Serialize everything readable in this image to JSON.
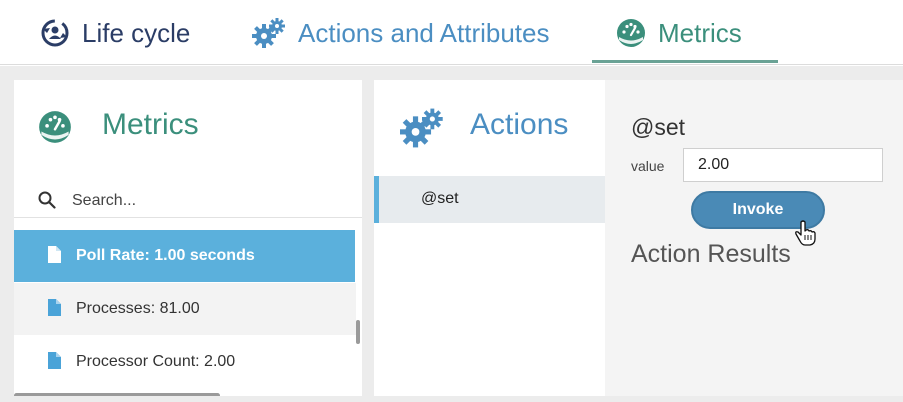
{
  "tabs": [
    {
      "label": "Life cycle",
      "icon": "lifecycle-icon",
      "color": "#2b3d66"
    },
    {
      "label": "Actions and Attributes",
      "icon": "gears-icon",
      "color": "#4b8ec2"
    },
    {
      "label": "Metrics",
      "icon": "gauge-icon",
      "color": "#3b8f7c",
      "active": true
    }
  ],
  "metrics_panel": {
    "title": "Metrics",
    "icon": "gauge-icon",
    "search_placeholder": "Search...",
    "items": [
      {
        "label": "Poll Rate: 1.00 seconds",
        "selected": true
      },
      {
        "label": "Processes: 81.00"
      },
      {
        "label": "Processor Count: 2.00"
      }
    ]
  },
  "actions_panel": {
    "title": "Actions",
    "icon": "gears-icon",
    "items": [
      {
        "label": "@set",
        "selected": true
      }
    ]
  },
  "action_detail": {
    "title": "@set",
    "value_label": "value",
    "value": "2.00",
    "invoke_label": "Invoke",
    "results_title": "Action Results"
  },
  "colors": {
    "accent_blue": "#5bb0dc",
    "teal": "#3b8f7c",
    "invoke": "#4a8ab6"
  }
}
